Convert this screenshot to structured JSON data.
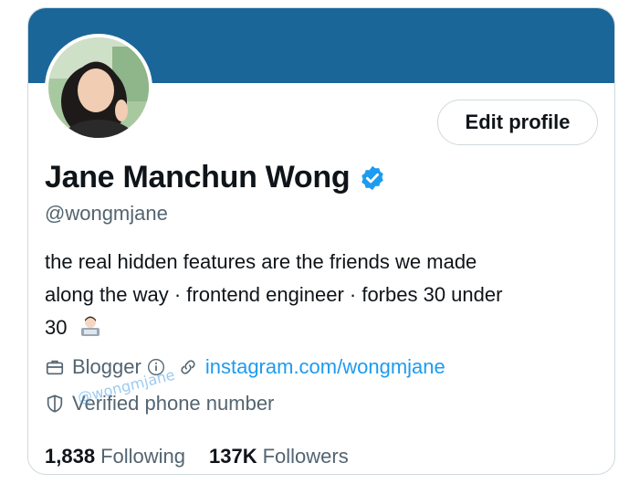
{
  "profile": {
    "name": "Jane Manchun Wong",
    "handle": "@wongmjane",
    "edit_label": "Edit profile",
    "bio_line1": "the real hidden features are the friends we made",
    "bio_line2": "along the way · frontend engineer · forbes 30 under",
    "bio_line3": "30",
    "category": "Blogger",
    "link_text": "instagram.com/wongmjane",
    "verified_phone": "Verified phone number",
    "following_count": "1,838",
    "following_label": "Following",
    "followers_count": "137K",
    "followers_label": "Followers"
  },
  "watermark": "@wongmjane",
  "colors": {
    "banner": "#1b6698",
    "link": "#1d9bf0",
    "verified": "#1d9bf0"
  },
  "icons": {
    "verified": "verified-badge-icon",
    "category": "briefcase-icon",
    "info": "info-icon",
    "link": "link-icon",
    "phone": "shield-icon"
  }
}
